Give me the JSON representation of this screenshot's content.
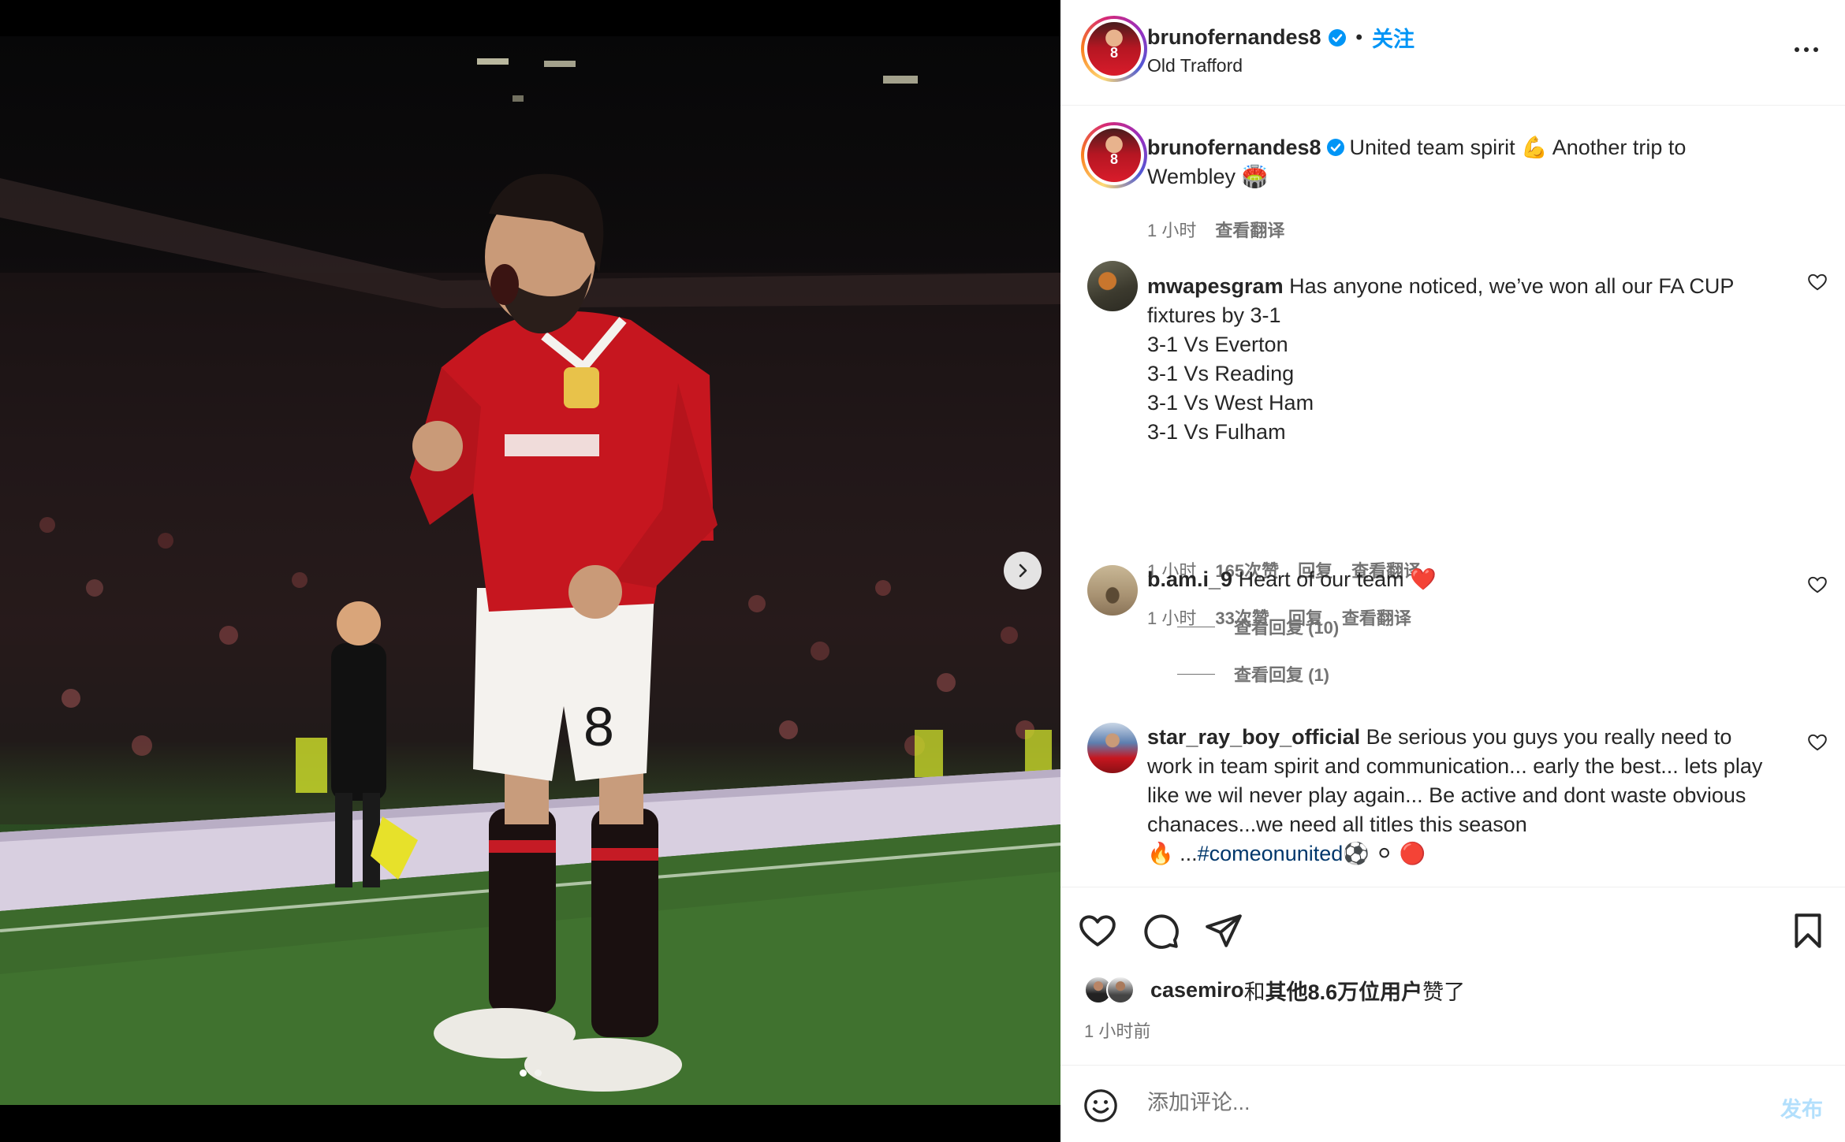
{
  "media": {
    "alt": "Bruno Fernandes celebrating at Old Trafford",
    "carousel_total": 2,
    "carousel_active": 1,
    "next_icon": "chevron-right-icon"
  },
  "header": {
    "username": "brunofernandes8",
    "verified": true,
    "separator": "•",
    "follow_label": "关注",
    "location": "Old Trafford",
    "more_icon": "more-options-icon"
  },
  "caption": {
    "username": "brunofernandes8",
    "text": "United team spirit 💪 Another trip to Wembley 🏟️",
    "time": "1 小时",
    "translate": "查看翻译"
  },
  "comments": [
    {
      "username": "mwapesgram",
      "lines": [
        "Has anyone noticed, we’ve won all our FA CUP fixtures by 3-1",
        "3-1 Vs Everton",
        "3-1 Vs Reading",
        "3-1 Vs West Ham",
        "3-1 Vs Fulham"
      ],
      "time": "1 小时",
      "likes": "165次赞",
      "reply": "回复",
      "translate": "查看翻译",
      "view_replies": "查看回复 (10)"
    },
    {
      "username": "b.am.i_9",
      "lines": [
        "Heart of our team ❤️"
      ],
      "time": "1 小时",
      "likes": "33次赞",
      "reply": "回复",
      "translate": "查看翻译",
      "view_replies": "查看回复 (1)"
    },
    {
      "username": "star_ray_boy_official",
      "lines": [
        "Be serious you guys you really need to work in team spirit and communication... early the best... lets play like we wil never play again... Be active and dont waste obvious chanaces...we need all titles this season"
      ],
      "tail_prefix": "🔥 ...",
      "hashtag": "#comeonunited",
      "tail_suffix": "⚽ ⚪ 🔴"
    }
  ],
  "actions": {
    "like_icon": "heart-icon",
    "comment_icon": "comment-icon",
    "share_icon": "share-icon",
    "save_icon": "bookmark-icon"
  },
  "likes": {
    "first_user": "casemiro",
    "connector": "和",
    "others": "其他8.6万位用户",
    "suffix": "赞了"
  },
  "timestamp": "1 小时前",
  "add_comment": {
    "emoji_icon": "emoji-icon",
    "placeholder": "添加评论...",
    "post_label": "发布"
  },
  "colors": {
    "accent": "#0095f6",
    "text": "#262626",
    "secondary": "#737373",
    "post_disabled": "#b2dffc",
    "hashtag": "#00376b"
  }
}
